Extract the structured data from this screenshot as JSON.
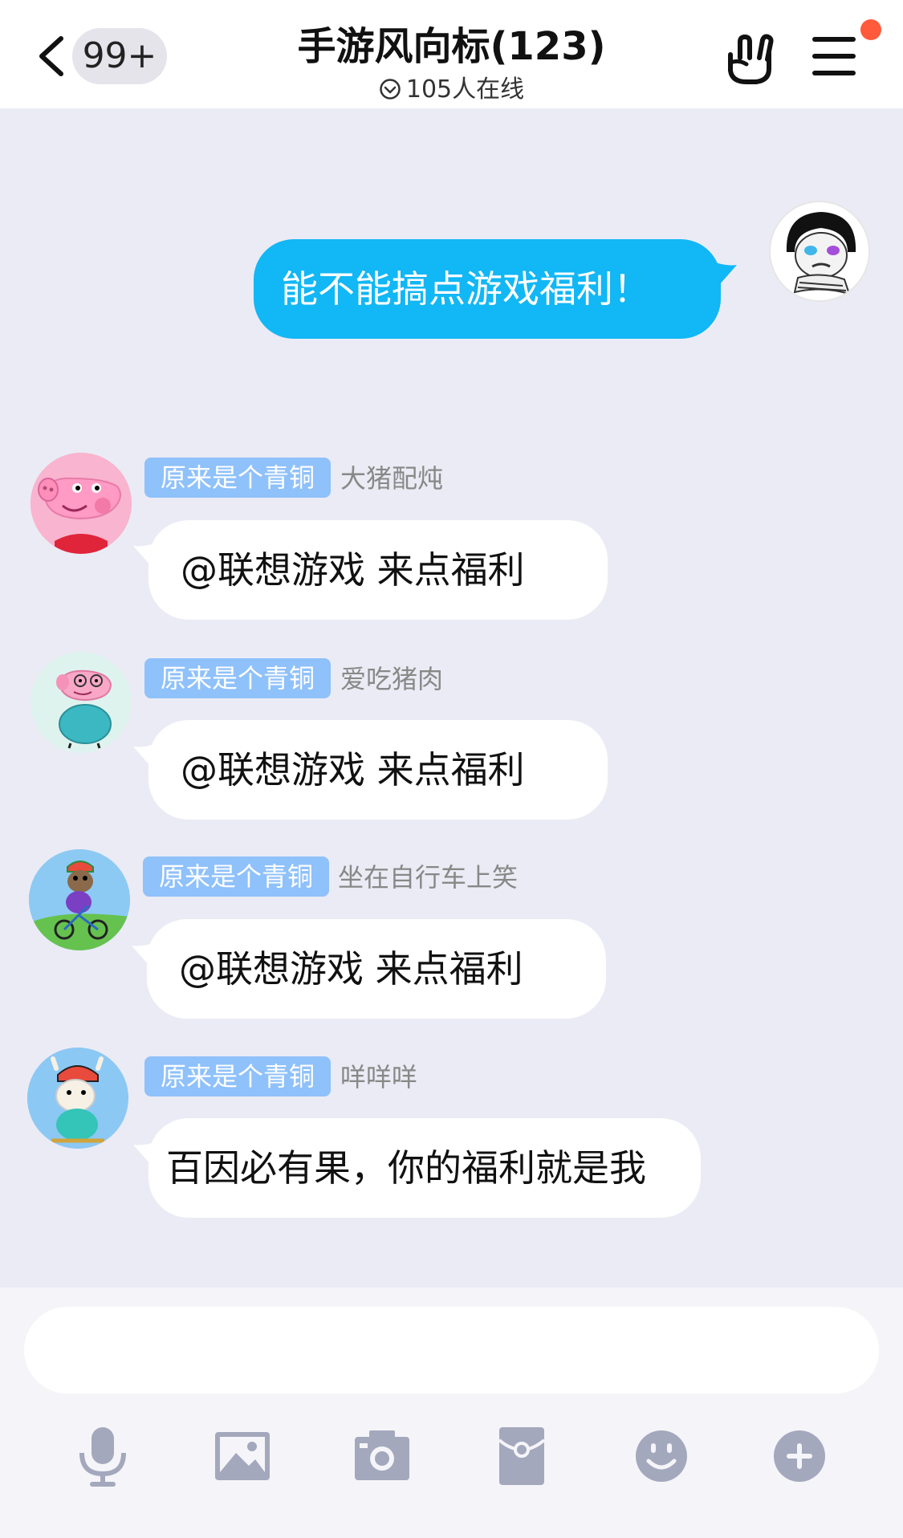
{
  "header": {
    "unread_count": "99+",
    "title": "手游风向标(123)",
    "online_status": "105人在线"
  },
  "messages": [
    {
      "side": "out",
      "text": "能不能搞点游戏福利！"
    },
    {
      "side": "in",
      "badge": "原来是个青铜",
      "nickname": "大猪配炖",
      "text": "@联想游戏 来点福利"
    },
    {
      "side": "in",
      "badge": "原来是个青铜",
      "nickname": "爱吃猪肉",
      "text": "@联想游戏 来点福利"
    },
    {
      "side": "in",
      "badge": "原来是个青铜",
      "nickname": "坐在自行车上笑",
      "text": "@联想游戏 来点福利"
    },
    {
      "side": "in",
      "badge": "原来是个青铜",
      "nickname": "咩咩咩",
      "text": "百因必有果，你的福利就是我"
    }
  ],
  "input": {
    "value": "",
    "placeholder": ""
  },
  "toolbar": [
    "microphone-icon",
    "image-icon",
    "camera-icon",
    "red-packet-icon",
    "emoji-icon",
    "plus-icon"
  ],
  "colors": {
    "accent_bubble": "#12b7f5",
    "badge": "#8fc1fb",
    "notification_dot": "#ff5a3c",
    "toolbar_icon": "#a4a8bd",
    "chat_background": "#ebebf5"
  }
}
